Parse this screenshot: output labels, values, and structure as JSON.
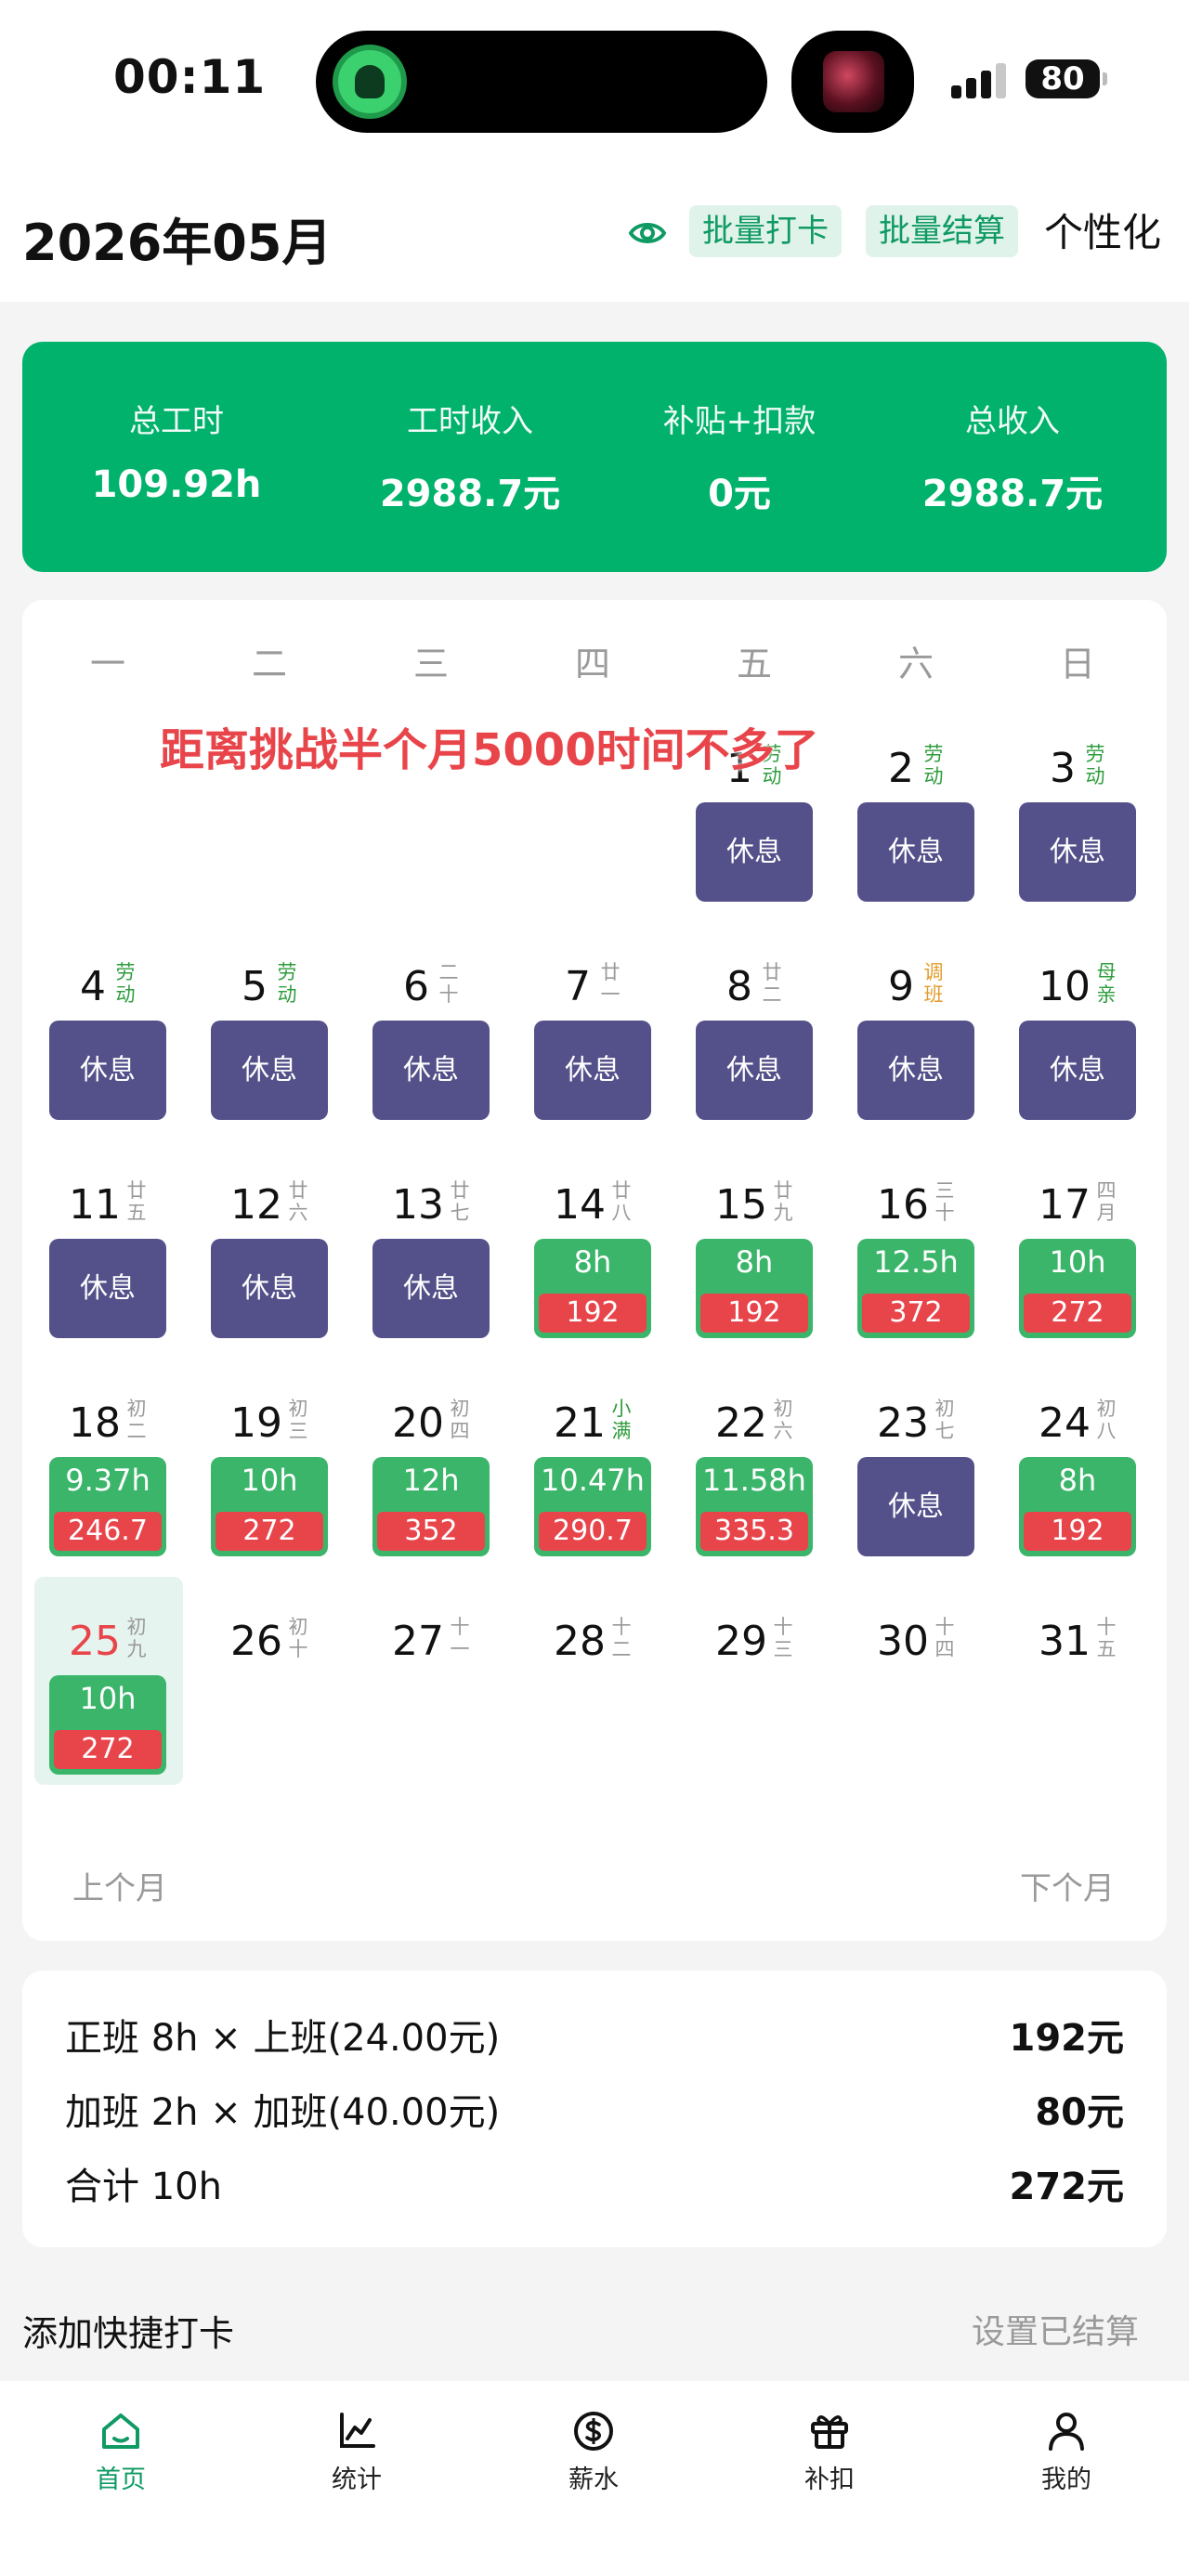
{
  "status_bar": {
    "time": "00:11",
    "battery": "80"
  },
  "header": {
    "title": "2026年05月",
    "batch_punch": "批量打卡",
    "batch_settle": "批量结算",
    "personalize": "个性化"
  },
  "summary": [
    {
      "label": "总工时",
      "value": "109.92h"
    },
    {
      "label": "工时收入",
      "value": "2988.7元"
    },
    {
      "label": "补贴+扣款",
      "value": "0元"
    },
    {
      "label": "总收入",
      "value": "2988.7元"
    }
  ],
  "calendar": {
    "weekdays": [
      "一",
      "二",
      "三",
      "四",
      "五",
      "六",
      "日"
    ],
    "banner": "距离挑战半个月5000时间不多了",
    "prev_month": "上个月",
    "next_month": "下个月",
    "today": 25,
    "days": [
      {
        "day": 1,
        "lunar": "劳动",
        "type": "hol",
        "status": "rest"
      },
      {
        "day": 2,
        "lunar": "劳动",
        "type": "hol",
        "status": "rest"
      },
      {
        "day": 3,
        "lunar": "劳动",
        "type": "hol",
        "status": "rest"
      },
      {
        "day": 4,
        "lunar": "劳动",
        "type": "hol",
        "status": "rest"
      },
      {
        "day": 5,
        "lunar": "劳动",
        "type": "hol",
        "status": "rest"
      },
      {
        "day": 6,
        "lunar": "二十",
        "type": "",
        "status": "rest"
      },
      {
        "day": 7,
        "lunar": "廿一",
        "type": "",
        "status": "rest"
      },
      {
        "day": 8,
        "lunar": "廿二",
        "type": "",
        "status": "rest"
      },
      {
        "day": 9,
        "lunar": "调班",
        "type": "adj",
        "status": "rest"
      },
      {
        "day": 10,
        "lunar": "母亲",
        "type": "hol",
        "status": "rest"
      },
      {
        "day": 11,
        "lunar": "廿五",
        "type": "",
        "status": "rest"
      },
      {
        "day": 12,
        "lunar": "廿六",
        "type": "",
        "status": "rest"
      },
      {
        "day": 13,
        "lunar": "廿七",
        "type": "",
        "status": "rest"
      },
      {
        "day": 14,
        "lunar": "廿八",
        "type": "",
        "status": "work",
        "hours": "8h",
        "pay": "192"
      },
      {
        "day": 15,
        "lunar": "廿九",
        "type": "",
        "status": "work",
        "hours": "8h",
        "pay": "192"
      },
      {
        "day": 16,
        "lunar": "三十",
        "type": "",
        "status": "work",
        "hours": "12.5h",
        "pay": "372"
      },
      {
        "day": 17,
        "lunar": "四月",
        "type": "",
        "status": "work",
        "hours": "10h",
        "pay": "272"
      },
      {
        "day": 18,
        "lunar": "初二",
        "type": "",
        "status": "work",
        "hours": "9.37h",
        "pay": "246.7"
      },
      {
        "day": 19,
        "lunar": "初三",
        "type": "",
        "status": "work",
        "hours": "10h",
        "pay": "272"
      },
      {
        "day": 20,
        "lunar": "初四",
        "type": "",
        "status": "work",
        "hours": "12h",
        "pay": "352"
      },
      {
        "day": 21,
        "lunar": "小满",
        "type": "hol",
        "status": "work",
        "hours": "10.47h",
        "pay": "290.7"
      },
      {
        "day": 22,
        "lunar": "初六",
        "type": "",
        "status": "work",
        "hours": "11.58h",
        "pay": "335.3"
      },
      {
        "day": 23,
        "lunar": "初七",
        "type": "",
        "status": "rest"
      },
      {
        "day": 24,
        "lunar": "初八",
        "type": "",
        "status": "work",
        "hours": "8h",
        "pay": "192"
      },
      {
        "day": 25,
        "lunar": "初九",
        "type": "",
        "status": "work",
        "hours": "10h",
        "pay": "272"
      },
      {
        "day": 26,
        "lunar": "初十",
        "type": "",
        "status": ""
      },
      {
        "day": 27,
        "lunar": "十一",
        "type": "",
        "status": ""
      },
      {
        "day": 28,
        "lunar": "十二",
        "type": "",
        "status": ""
      },
      {
        "day": 29,
        "lunar": "十三",
        "type": "",
        "status": ""
      },
      {
        "day": 30,
        "lunar": "十四",
        "type": "",
        "status": ""
      },
      {
        "day": 31,
        "lunar": "十五",
        "type": "",
        "status": ""
      }
    ],
    "rest_label": "休息"
  },
  "detail": {
    "rows": [
      {
        "label": "正班 8h × 上班(24.00元)",
        "amount": "192元"
      },
      {
        "label": "加班 2h × 加班(40.00元)",
        "amount": "80元"
      },
      {
        "label": "合计 10h",
        "amount": "272元"
      }
    ]
  },
  "quick": {
    "add": "添加快捷打卡",
    "settled": "设置已结算"
  },
  "tabs": [
    {
      "label": "首页",
      "icon": "home-icon",
      "active": true
    },
    {
      "label": "统计",
      "icon": "chart-icon",
      "active": false
    },
    {
      "label": "薪水",
      "icon": "salary-icon",
      "active": false
    },
    {
      "label": "补扣",
      "icon": "gift-icon",
      "active": false
    },
    {
      "label": "我的",
      "icon": "profile-icon",
      "active": false
    }
  ],
  "colors": {
    "accent": "#00b26b",
    "rest": "#53508a",
    "work": "#3bb56a",
    "pay": "#e8454b"
  }
}
